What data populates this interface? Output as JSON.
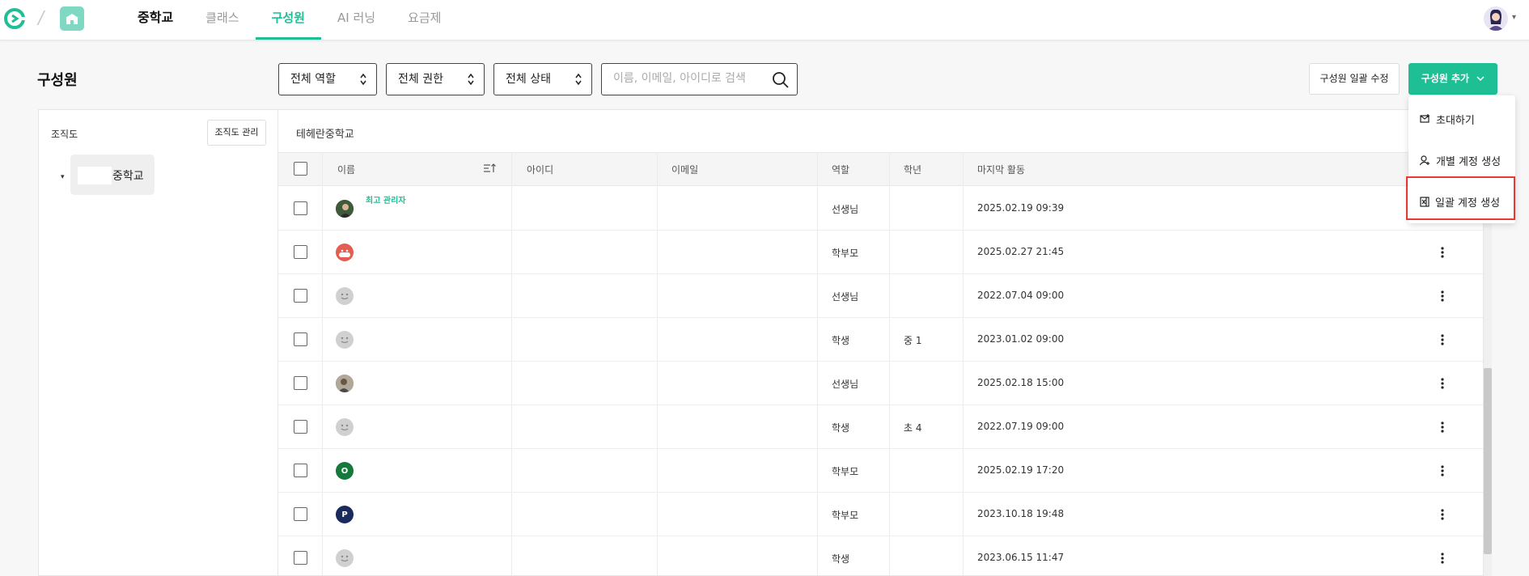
{
  "nav": {
    "school": "중학교",
    "items": [
      "클래스",
      "구성원",
      "AI 러닝",
      "요금제"
    ]
  },
  "page": {
    "title": "구성원"
  },
  "filters": {
    "role": "전체 역할",
    "permission": "전체 권한",
    "status": "전체 상태",
    "search_placeholder": "이름, 이메일, 아이디로 검색"
  },
  "actions": {
    "bulk_edit": "구성원 일괄 수정",
    "add_member": "구성원 추가"
  },
  "dropdown": {
    "items": [
      "초대하기",
      "개별 계정 생성",
      "일괄 계정 생성"
    ]
  },
  "org": {
    "title": "조직도",
    "manage": "조직도 관리",
    "node": "중학교"
  },
  "table": {
    "breadcrumb": "테헤란중학교",
    "headers": [
      "이름",
      "아이디",
      "이메일",
      "역할",
      "학년",
      "마지막 활동"
    ],
    "admin_badge": "최고 관리자",
    "rows": [
      {
        "role": "선생님",
        "grade": "",
        "last": "2025.02.19 09:39",
        "avatar_letter": ""
      },
      {
        "role": "학부모",
        "grade": "",
        "last": "2025.02.27 21:45",
        "avatar_letter": ""
      },
      {
        "role": "선생님",
        "grade": "",
        "last": "2022.07.04 09:00",
        "avatar_letter": ""
      },
      {
        "role": "학생",
        "grade": "중 1",
        "last": "2023.01.02 09:00",
        "avatar_letter": ""
      },
      {
        "role": "선생님",
        "grade": "",
        "last": "2025.02.18 15:00",
        "avatar_letter": ""
      },
      {
        "role": "학생",
        "grade": "초 4",
        "last": "2022.07.19 09:00",
        "avatar_letter": ""
      },
      {
        "role": "학부모",
        "grade": "",
        "last": "2025.02.19 17:20",
        "avatar_letter": "O"
      },
      {
        "role": "학부모",
        "grade": "",
        "last": "2023.10.18 19:48",
        "avatar_letter": "P"
      },
      {
        "role": "학생",
        "grade": "",
        "last": "2023.06.15 11:47",
        "avatar_letter": ""
      }
    ]
  },
  "colors": {
    "accent": "#1fbf95",
    "highlight": "#e53935"
  }
}
